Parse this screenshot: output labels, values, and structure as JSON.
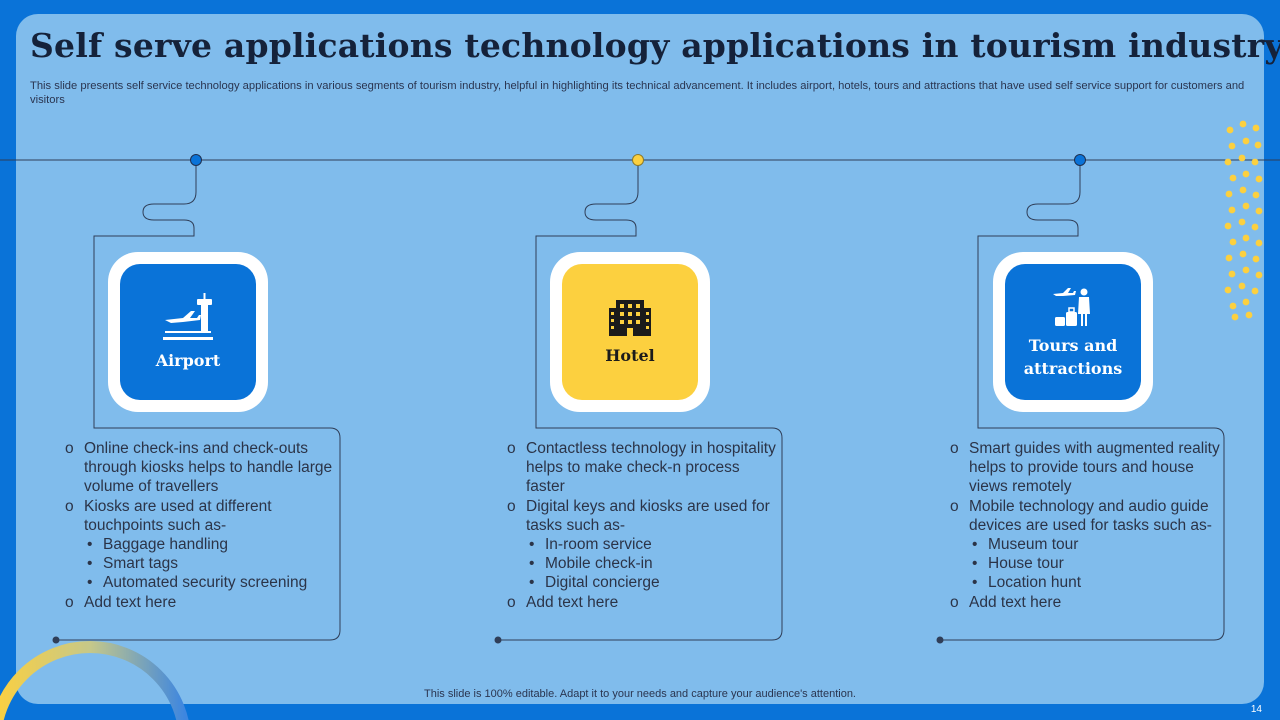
{
  "title": "Self  serve applications technology applications in tourism industry",
  "subtitle": "This slide presents self service technology applications in various segments of tourism industry, helpful in highlighting its technical advancement. It includes airport, hotels, tours and attractions that have used self service support for customers and visitors",
  "colors": {
    "background": "#0a73d8",
    "panel": "#80bcec",
    "accent_yellow": "#fcd03f",
    "accent_blue": "#0a73d8"
  },
  "segments": [
    {
      "label": "Airport",
      "icon": "airport-tower-icon",
      "items": [
        {
          "text": "Online check-ins and check-outs through  kiosks helps to handle large volume  of travellers",
          "level": 1
        },
        {
          "text": "Kiosks are used at different touchpoints such as-",
          "level": 1
        },
        {
          "text": "Baggage handling",
          "level": 2
        },
        {
          "text": "Smart tags",
          "level": 2
        },
        {
          "text": "Automated security screening",
          "level": 2
        },
        {
          "text": "Add text here",
          "level": 1
        }
      ]
    },
    {
      "label": "Hotel",
      "icon": "hotel-building-icon",
      "items": [
        {
          "text": "Contactless technology  in hospitality helps to make check-n process faster",
          "level": 1
        },
        {
          "text": "Digital keys and kiosks are used for tasks such as-",
          "level": 1
        },
        {
          "text": "In-room  service",
          "level": 2
        },
        {
          "text": "Mobile check-in",
          "level": 2
        },
        {
          "text": "Digital concierge",
          "level": 2
        },
        {
          "text": "Add text here",
          "level": 1
        }
      ]
    },
    {
      "label": "Tours and attractions",
      "icon": "traveler-luggage-icon",
      "items": [
        {
          "text": "Smart guides  with augmented reality helps to provide tours and house views remotely",
          "level": 1
        },
        {
          "text": "Mobile technology  and audio guide devices are used for tasks such as-",
          "level": 1
        },
        {
          "text": "Museum tour",
          "level": 2
        },
        {
          "text": "House tour",
          "level": 2
        },
        {
          "text": "Location hunt",
          "level": 2
        },
        {
          "text": "Add text here",
          "level": 1
        }
      ]
    }
  ],
  "footer": "This slide is 100% editable. Adapt it to your needs and capture your audience's attention.",
  "page_number": "14"
}
